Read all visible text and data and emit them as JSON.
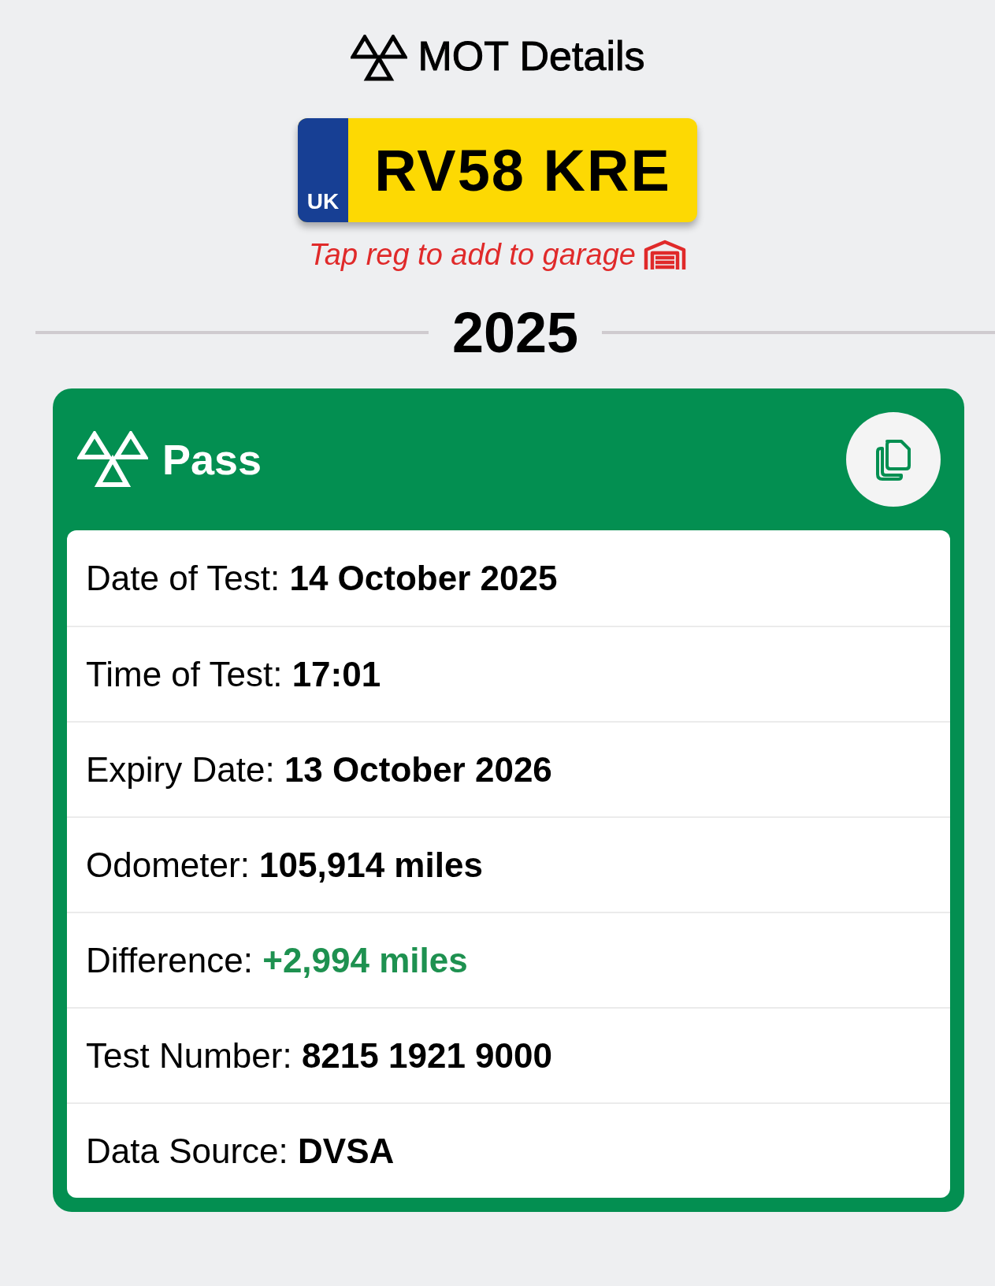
{
  "title": "MOT Details",
  "plate": {
    "country": "UK",
    "registration": "RV58 KRE"
  },
  "garage_hint": "Tap reg to add to garage",
  "year": "2025",
  "test": {
    "result": "Pass",
    "rows": [
      {
        "label": "Date of Test:",
        "value": "14 October 2025",
        "kind": "plain"
      },
      {
        "label": "Time of Test:",
        "value": "17:01",
        "kind": "plain"
      },
      {
        "label": "Expiry Date:",
        "value": "13 October 2026",
        "kind": "plain"
      },
      {
        "label": "Odometer:",
        "value": "105,914 miles",
        "kind": "plain"
      },
      {
        "label": "Difference:",
        "value": "+2,994 miles",
        "kind": "positive"
      },
      {
        "label": "Test Number:",
        "value": "8215 1921 9000",
        "kind": "plain"
      },
      {
        "label": "Data Source:",
        "value": "DVSA",
        "kind": "plain"
      }
    ]
  }
}
